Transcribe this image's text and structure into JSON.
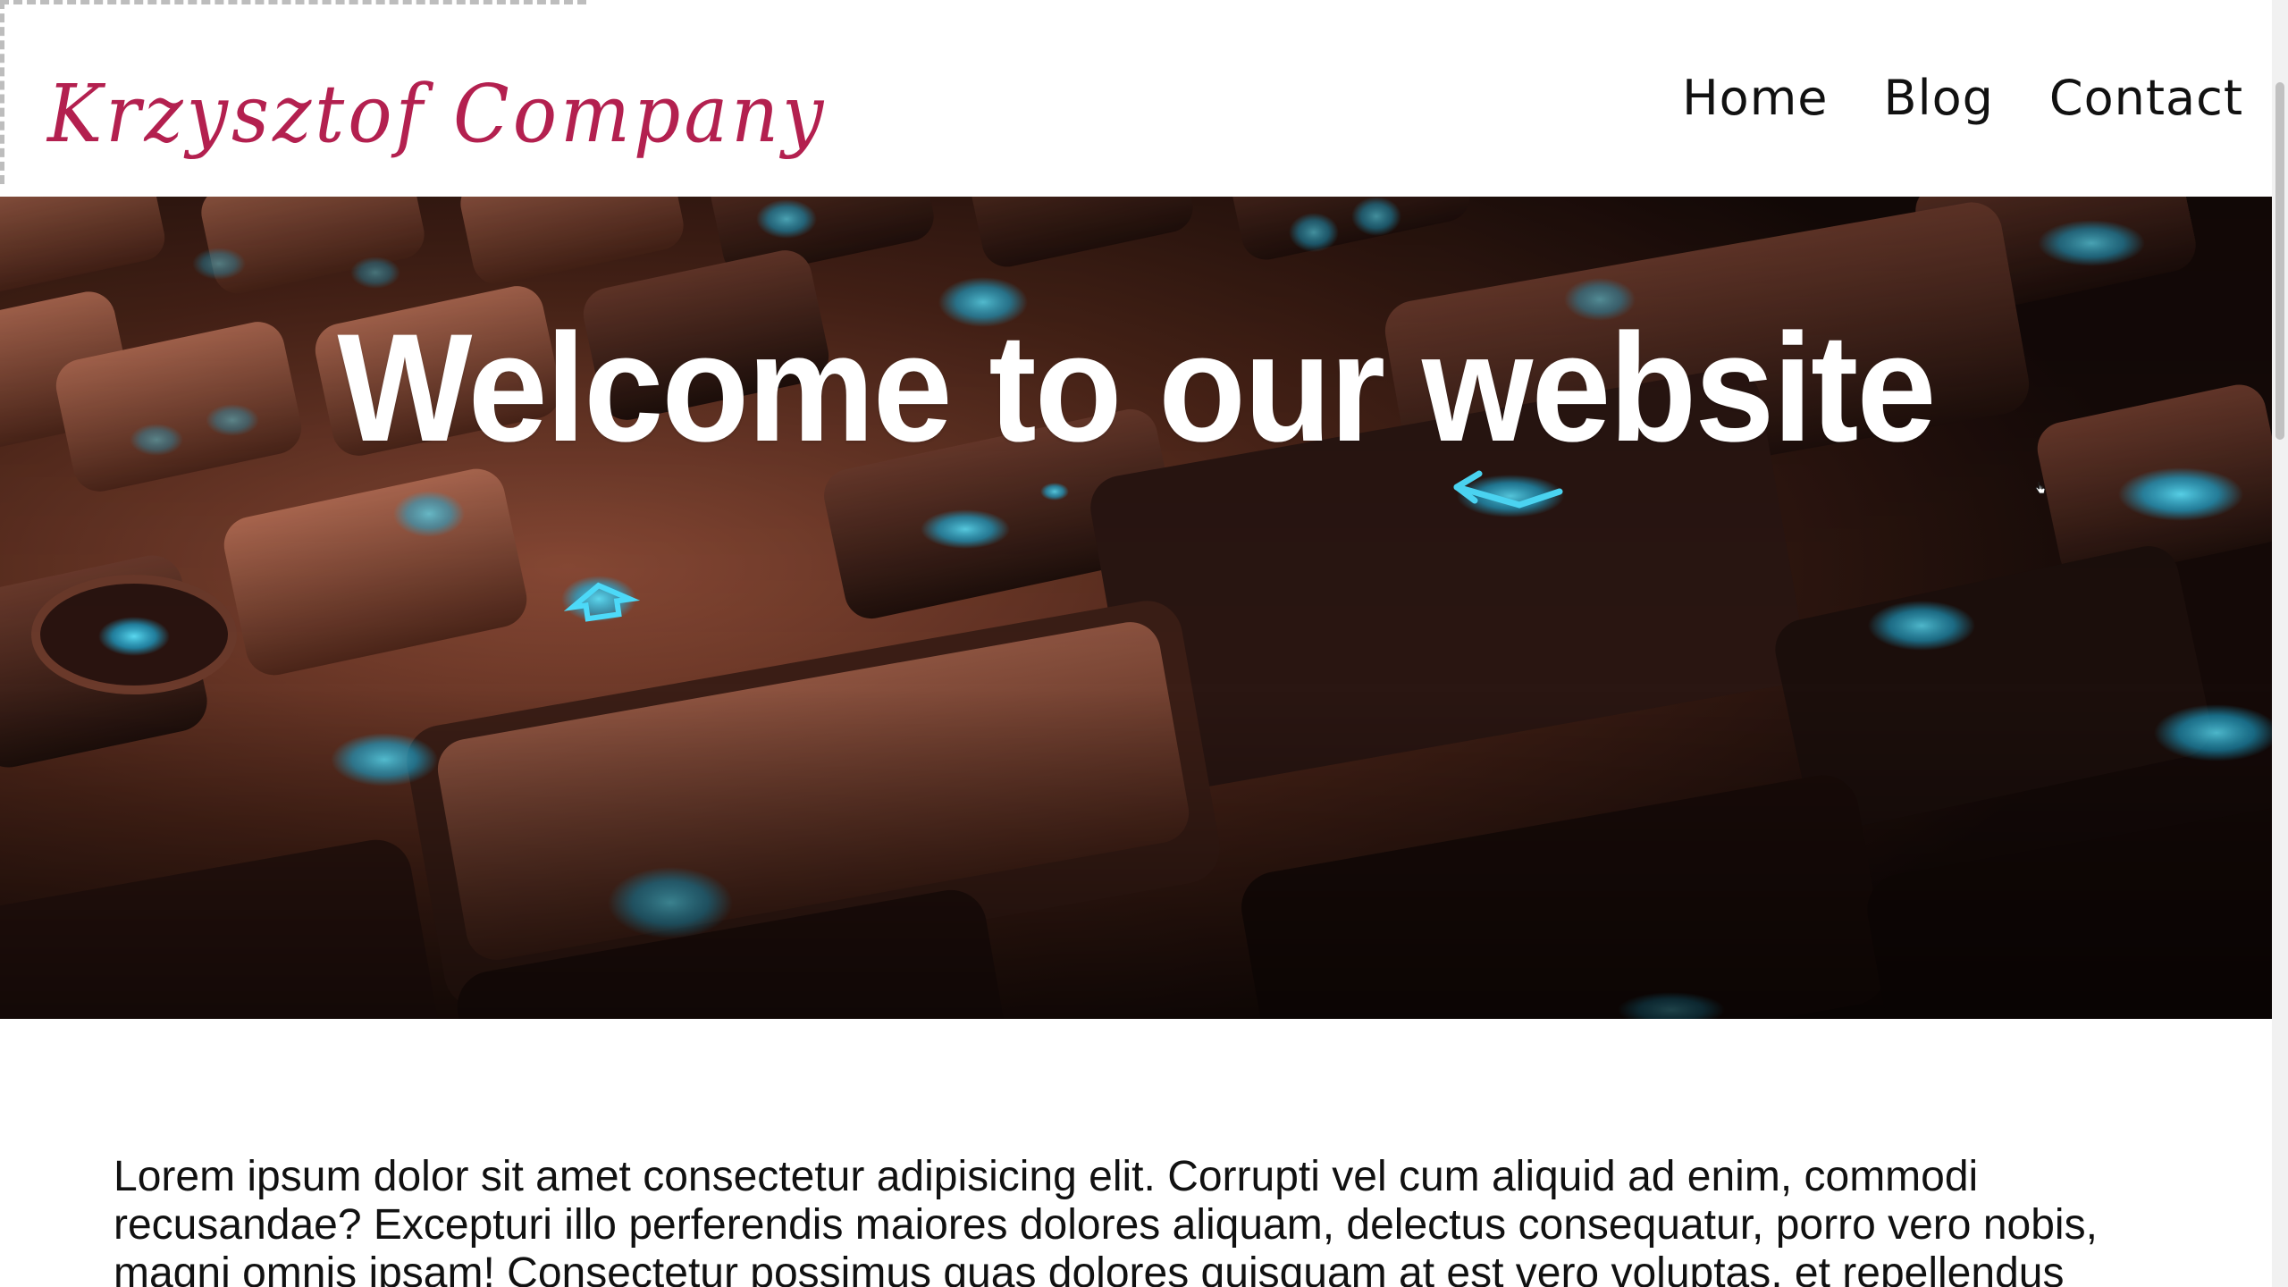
{
  "header": {
    "logo_text": "Krzysztof Company",
    "nav": [
      {
        "label": "Home"
      },
      {
        "label": "Blog"
      },
      {
        "label": "Contact"
      }
    ]
  },
  "hero": {
    "title": "Welcome to our website",
    "background_description_icon": "keyboard-photo"
  },
  "content": {
    "paragraph": "Lorem ipsum dolor sit amet consectetur adipisicing elit. Corrupti vel cum aliquid ad enim, commodi recusandae? Excepturi illo perferendis maiores dolores aliquam, delectus consequatur, porro vero nobis, magni omnis ipsam! Consectetur possimus quas dolores quisquam at est vero voluptas, et repellendus"
  },
  "colors": {
    "logo": "#b3204f",
    "nav_text": "#111111",
    "hero_title": "#ffffff"
  }
}
